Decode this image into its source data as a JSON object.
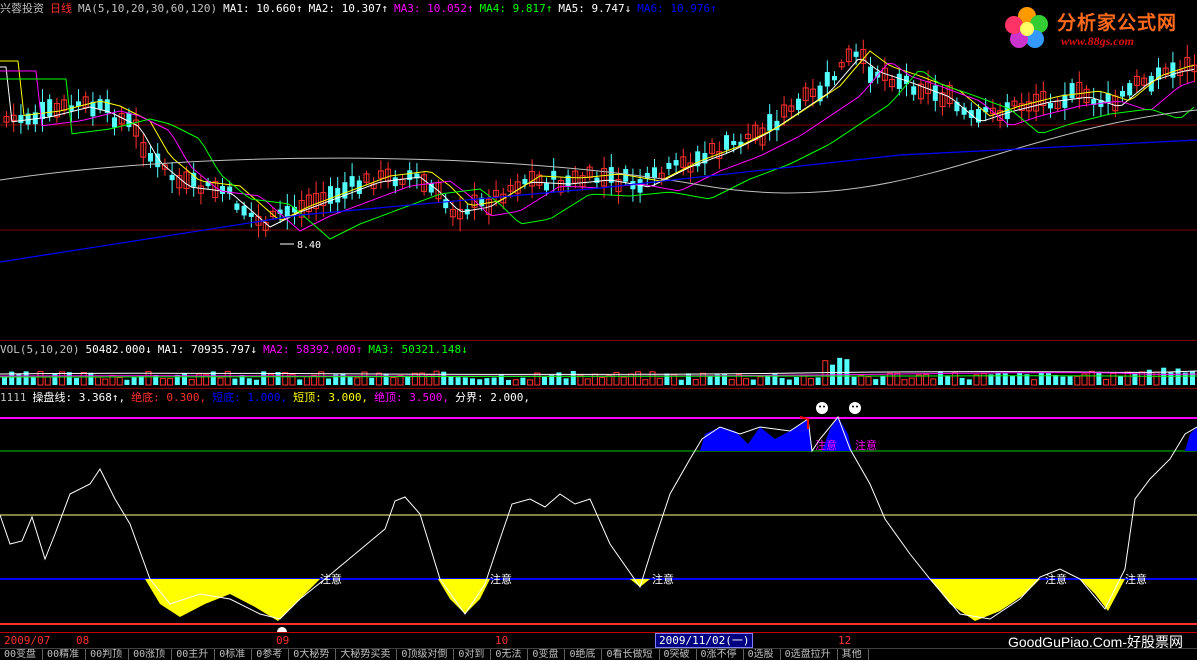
{
  "header_main": [
    {
      "text": "兴蓉投资",
      "color": "#c0c0c0"
    },
    {
      "text": "日线",
      "color": "#ff3030"
    },
    {
      "text": "MA(5,10,20,30,60,120)",
      "color": "#c0c0c0"
    },
    {
      "text": "MA1: 10.660↑",
      "color": "#ffffff"
    },
    {
      "text": "MA2: 10.307↑",
      "color": "#ffffff"
    },
    {
      "text": "MA3: 10.052↑",
      "color": "#ff00ff"
    },
    {
      "text": "MA4: 9.817↑",
      "color": "#00ff00"
    },
    {
      "text": "MA5: 9.747↓",
      "color": "#ffffff"
    },
    {
      "text": "MA6: 10.976↑",
      "color": "#0000ff"
    }
  ],
  "low_price_label": "8.40",
  "header_vol": [
    {
      "text": "VOL(5,10,20)",
      "color": "#c0c0c0"
    },
    {
      "text": "50482.000↓",
      "color": "#ffffff"
    },
    {
      "text": "MA1: 70935.797↓",
      "color": "#ffffff"
    },
    {
      "text": "MA2: 58392.000↑",
      "color": "#ff00ff"
    },
    {
      "text": "MA3: 50321.148↓",
      "color": "#00ff00"
    }
  ],
  "header_ind": [
    {
      "text": "1111",
      "color": "#c0c0c0"
    },
    {
      "text": "操盘线: 3.368↑,",
      "color": "#ffffff"
    },
    {
      "text": "绝底: 0.300,",
      "color": "#ff3030"
    },
    {
      "text": "短底: 1.000,",
      "color": "#0000ff"
    },
    {
      "text": "短顶: 3.000,",
      "color": "#ffff00"
    },
    {
      "text": "绝顶: 3.500,",
      "color": "#ff00ff"
    },
    {
      "text": "分界: 2.000,",
      "color": "#ffffff"
    }
  ],
  "warn_text": "注意",
  "date_labels": [
    "2009/07",
    "08",
    "09",
    "10",
    "12"
  ],
  "selected_date": "2009/11/02(一)",
  "logo": {
    "cn": "分析家公式网",
    "url": "www.88gs.com"
  },
  "watermark": "GoodGuPiao.Com-好股票网",
  "bottom_tabs": [
    "00变盘",
    "00精准",
    "00判顶",
    "00涨顶",
    "00主升",
    "0标准",
    "0参考",
    "0大秘势",
    "大秘势买卖",
    "0顶级对倒",
    "0对到",
    "0无法",
    "0变盘",
    "0绝底",
    "0看长做短",
    "0突破",
    "0涨不停",
    "0选股",
    "0选盘拉升",
    "其他"
  ],
  "colors": {
    "up": "#ff3030",
    "down": "#54ffff",
    "ma_white": "#ffffff",
    "ma_yellow": "#ffff00",
    "ma_magenta": "#ff00ff",
    "ma_green": "#00ff00",
    "ma_gray": "#c0c0c0",
    "ma_blue": "#0000ff",
    "fill_yellow": "#ffff00",
    "fill_blue": "#0000ff"
  }
}
